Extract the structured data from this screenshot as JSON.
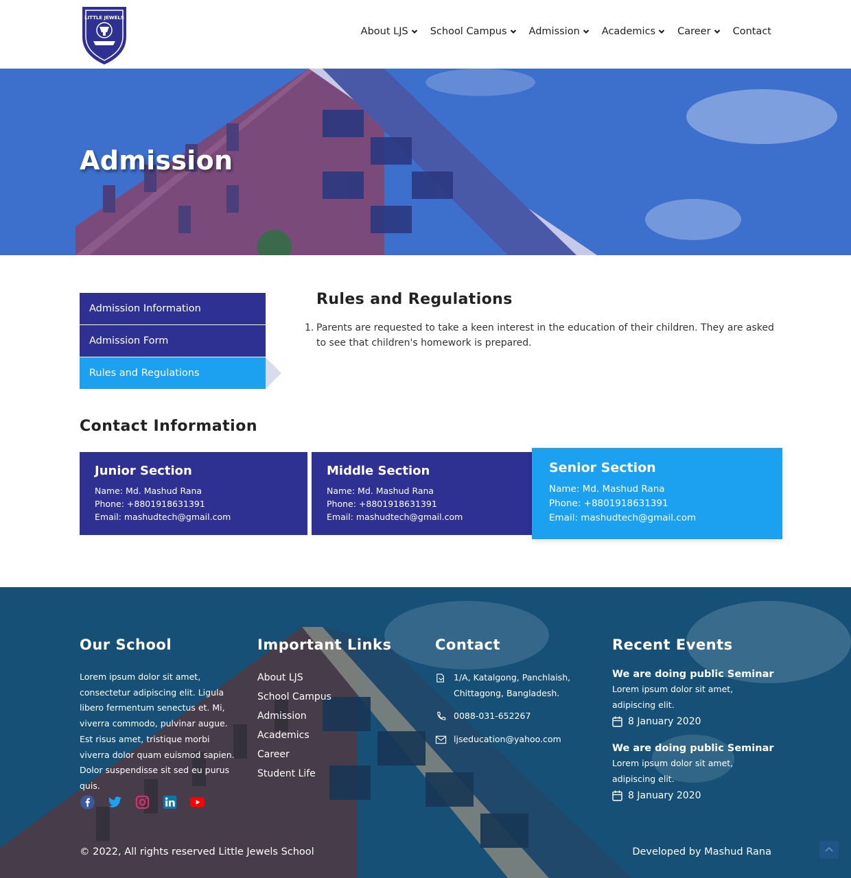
{
  "header": {
    "logo_text": "LITTLE JEWELS",
    "nav": [
      {
        "label": "About LJS",
        "dropdown": true
      },
      {
        "label": "School Campus",
        "dropdown": true
      },
      {
        "label": "Admission",
        "dropdown": true
      },
      {
        "label": "Academics",
        "dropdown": true
      },
      {
        "label": "Career",
        "dropdown": true
      },
      {
        "label": "Contact",
        "dropdown": false
      }
    ]
  },
  "hero": {
    "title": "Admission"
  },
  "sidebar": {
    "items": [
      {
        "label": "Admission Information"
      },
      {
        "label": "Admission Form"
      },
      {
        "label": "Rules and Regulations",
        "active": true
      }
    ]
  },
  "rules": {
    "title": "Rules and Regulations",
    "items": [
      {
        "num": "1.",
        "text": "Parents are requested to take a keen interest in the education of their children. They are asked to see that children's homework is prepared."
      }
    ]
  },
  "contact_info": {
    "title": "Contact Information",
    "cards": [
      {
        "title": "Junior Section",
        "name": "Name: Md. Mashud Rana",
        "phone": "Phone: +8801918631391",
        "email": "Email: mashudtech@gmail.com"
      },
      {
        "title": "Middle Section",
        "name": "Name: Md. Mashud Rana",
        "phone": "Phone: +8801918631391",
        "email": "Email: mashudtech@gmail.com"
      },
      {
        "title": "Senior Section",
        "name": "Name: Md. Mashud Rana",
        "phone": "Phone: +8801918631391",
        "email": "Email: mashudtech@gmail.com"
      }
    ]
  },
  "footer": {
    "our_school": {
      "title": "Our School",
      "text": "Lorem ipsum dolor sit amet, consectetur adipiscing elit. Ligula libero fermentum senectus et. Mi, viverra commodo, pulvinar augue. Est risus amet, tristique morbi viverra dolor quam euismod sapien. Dolor suspendisse sit sed eu purus quis."
    },
    "social": [
      "facebook-icon",
      "twitter-icon",
      "instagram-icon",
      "linkedin-icon",
      "youtube-icon"
    ],
    "links": {
      "title": "Important Links",
      "items": [
        "About LJS",
        "School Campus",
        "Admission",
        "Academics",
        "Career",
        "Student Life"
      ]
    },
    "contact": {
      "title": "Contact",
      "address": "1/A, Katalgong, Panchlaish, Chittagong, Bangladesh.",
      "phone": "0088-031-652267",
      "email": "ljseducation@yahoo.com"
    },
    "events": {
      "title": "Recent Events",
      "items": [
        {
          "title": "We are doing public Seminar",
          "text": "Lorem ipsum dolor sit amet, adipiscing elit.",
          "date": "8 January 2020"
        },
        {
          "title": "We are doing public Seminar",
          "text": "Lorem ipsum dolor sit amet, adipiscing elit.",
          "date": "8 January 2020"
        }
      ]
    },
    "copyright": "© 2022, All rights reserved Little Jewels School",
    "developer": "Developed by Mashud Rana"
  },
  "colors": {
    "primary": "#2e3192",
    "accent": "#1ca1f0",
    "hero": "#3b6fc8",
    "footer": "#1f5f86"
  }
}
